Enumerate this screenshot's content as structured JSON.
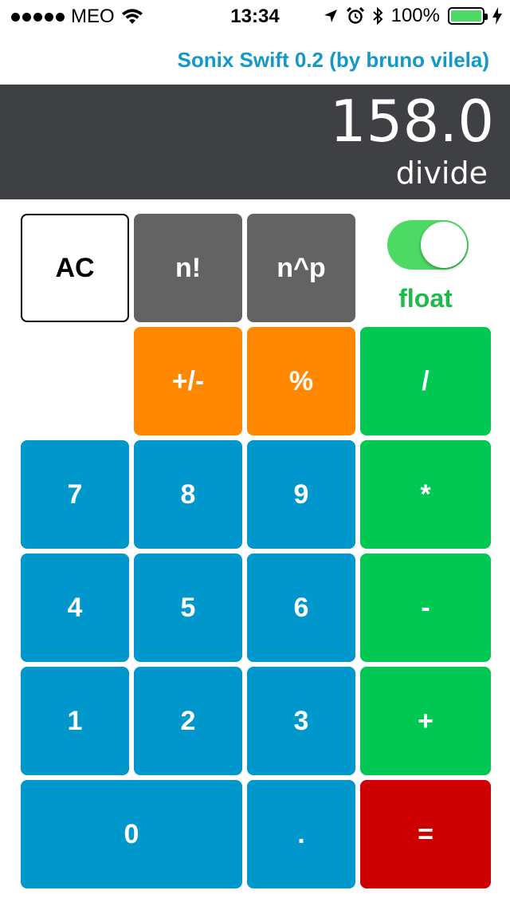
{
  "status_bar": {
    "carrier": "MEO",
    "time": "13:34",
    "battery": "100%",
    "battery_level": 1.0
  },
  "header": {
    "title": "Sonix Swift 0.2 (by bruno vilela)"
  },
  "display": {
    "value": "158.0",
    "operation": "divide"
  },
  "toggle": {
    "label": "float",
    "on": true
  },
  "keys": {
    "ac": "AC",
    "factorial": "n!",
    "power": "n^p",
    "sign": "+/-",
    "percent": "%",
    "divide": "/",
    "seven": "7",
    "eight": "8",
    "nine": "9",
    "multiply": "*",
    "four": "4",
    "five": "5",
    "six": "6",
    "minus": "-",
    "one": "1",
    "two": "2",
    "three": "3",
    "plus": "+",
    "zero": "0",
    "decimal": ".",
    "equals": "="
  },
  "colors": {
    "title": "#1597c8",
    "display_bg": "#3e4043",
    "gray_key": "#636363",
    "orange_key": "#ff8800",
    "green_key": "#00c853",
    "blue_key": "#0097cc",
    "red_key": "#cc0000",
    "toggle_on": "#4cd964"
  }
}
